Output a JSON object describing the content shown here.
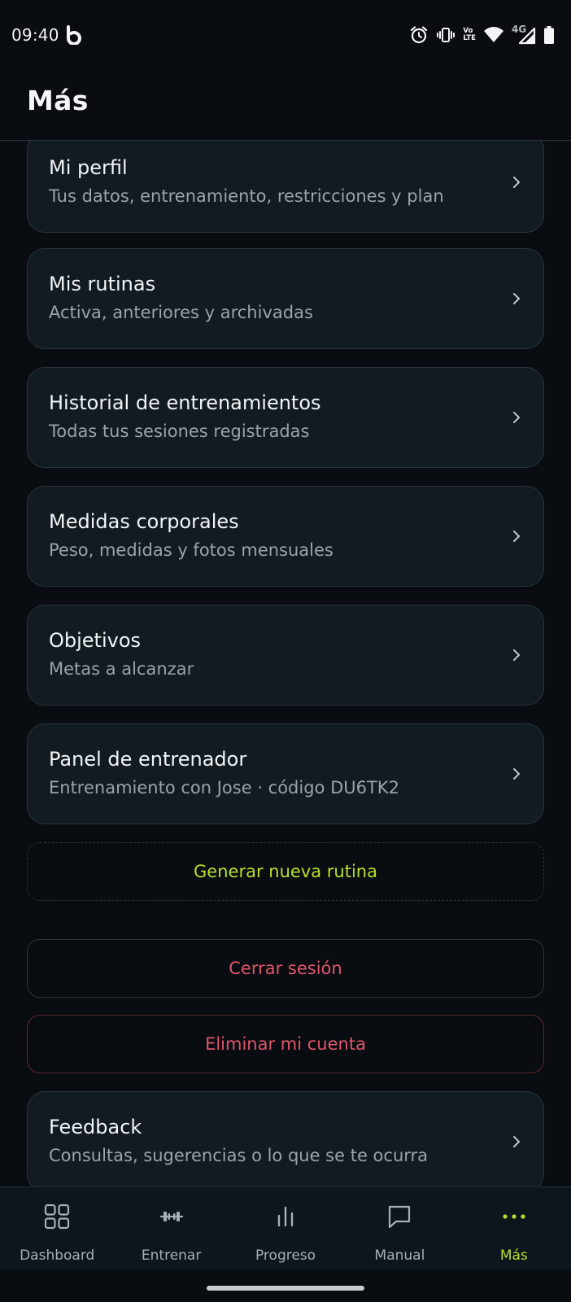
{
  "status_bar": {
    "time": "09:40",
    "network_label": "4G",
    "volte_label_top": "Vo",
    "volte_label_bottom": "LTE",
    "icons": [
      "app-b-logo-icon",
      "alarm-icon",
      "vibrate-icon",
      "volte-icon",
      "wifi-icon",
      "signal-icon",
      "battery-icon"
    ]
  },
  "header": {
    "title": "Más"
  },
  "menu": {
    "items": [
      {
        "title": "Mi perfil",
        "subtitle": "Tus datos, entrenamiento, restricciones y plan"
      },
      {
        "title": "Mis rutinas",
        "subtitle": "Activa, anteriores y archivadas"
      },
      {
        "title": "Historial de entrenamientos",
        "subtitle": "Todas tus sesiones registradas"
      },
      {
        "title": "Medidas corporales",
        "subtitle": "Peso, medidas y fotos mensuales"
      },
      {
        "title": "Objetivos",
        "subtitle": "Metas a alcanzar"
      },
      {
        "title": "Panel de entrenador",
        "subtitle": "Entrenamiento con Jose · código DU6TK2"
      }
    ],
    "generate_label": "Generar nueva rutina",
    "logout_label": "Cerrar sesión",
    "delete_label": "Eliminar mi cuenta",
    "feedback": {
      "title": "Feedback",
      "subtitle": "Consultas, sugerencias o lo que se te ocurra"
    }
  },
  "bottom_nav": {
    "items": [
      {
        "label": "Dashboard",
        "icon": "grid-icon"
      },
      {
        "label": "Entrenar",
        "icon": "dumbbell-icon"
      },
      {
        "label": "Progreso",
        "icon": "bar-chart-icon"
      },
      {
        "label": "Manual",
        "icon": "message-square-icon"
      },
      {
        "label": "Más",
        "icon": "more-dots-icon"
      }
    ],
    "active": "Más"
  },
  "colors": {
    "background": "#090c10",
    "card": "#131b22",
    "accent": "#b6e02c",
    "danger": "#e0566a",
    "muted_text": "#9aa2aa"
  }
}
